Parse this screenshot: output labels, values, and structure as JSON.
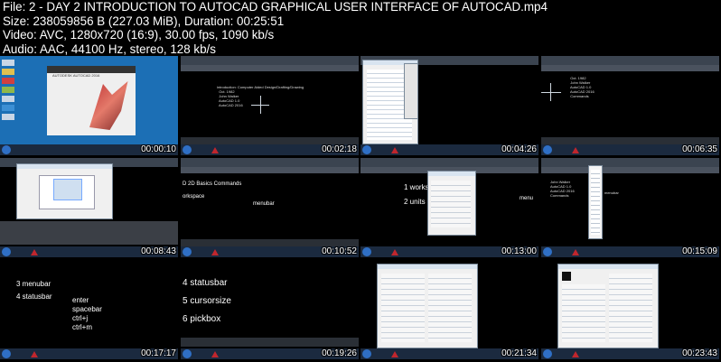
{
  "header": {
    "file": "File: 2 - DAY 2 INTRODUCTION TO AUTOCAD GRAPHICAL USER INTERFACE OF AUTOCAD.mp4",
    "size": "Size: 238059856 B (227.03 MiB), Duration: 00:25:51",
    "video": "Video: AVC, 1280x720 (16:9), 30.00 fps, 1090 kb/s",
    "audio": "Audio: AAC, 44100 Hz, stereo, 128 kb/s"
  },
  "thumbnails": [
    {
      "time": "00:00:10",
      "splash_brand": "AUTODESK AUTOCAD 2016"
    },
    {
      "time": "00:02:18"
    },
    {
      "time": "00:04:26"
    },
    {
      "time": "00:06:35"
    },
    {
      "time": "00:08:43"
    },
    {
      "time": "00:10:52",
      "texts": [
        "D 2D Basics Commands",
        "orkspace",
        "menubar"
      ]
    },
    {
      "time": "00:13:00",
      "texts": [
        "1 works",
        "2 units",
        "menu"
      ]
    },
    {
      "time": "00:15:09"
    },
    {
      "time": "00:17:17",
      "texts": [
        "3 menubar",
        "4 statusbar",
        "enter",
        "spacebar",
        "ctrl+j",
        "ctrl+m"
      ]
    },
    {
      "time": "00:19:26",
      "texts": [
        "4 statusbar",
        "5 cursorsize",
        "6 pickbox"
      ]
    },
    {
      "time": "00:21:34"
    },
    {
      "time": "00:23:43"
    }
  ],
  "colors": {
    "background": "#000000",
    "autocad_red": "#c0262d",
    "taskbar": "#1b2a3f",
    "desktop_blue": "#1c6fb5"
  }
}
